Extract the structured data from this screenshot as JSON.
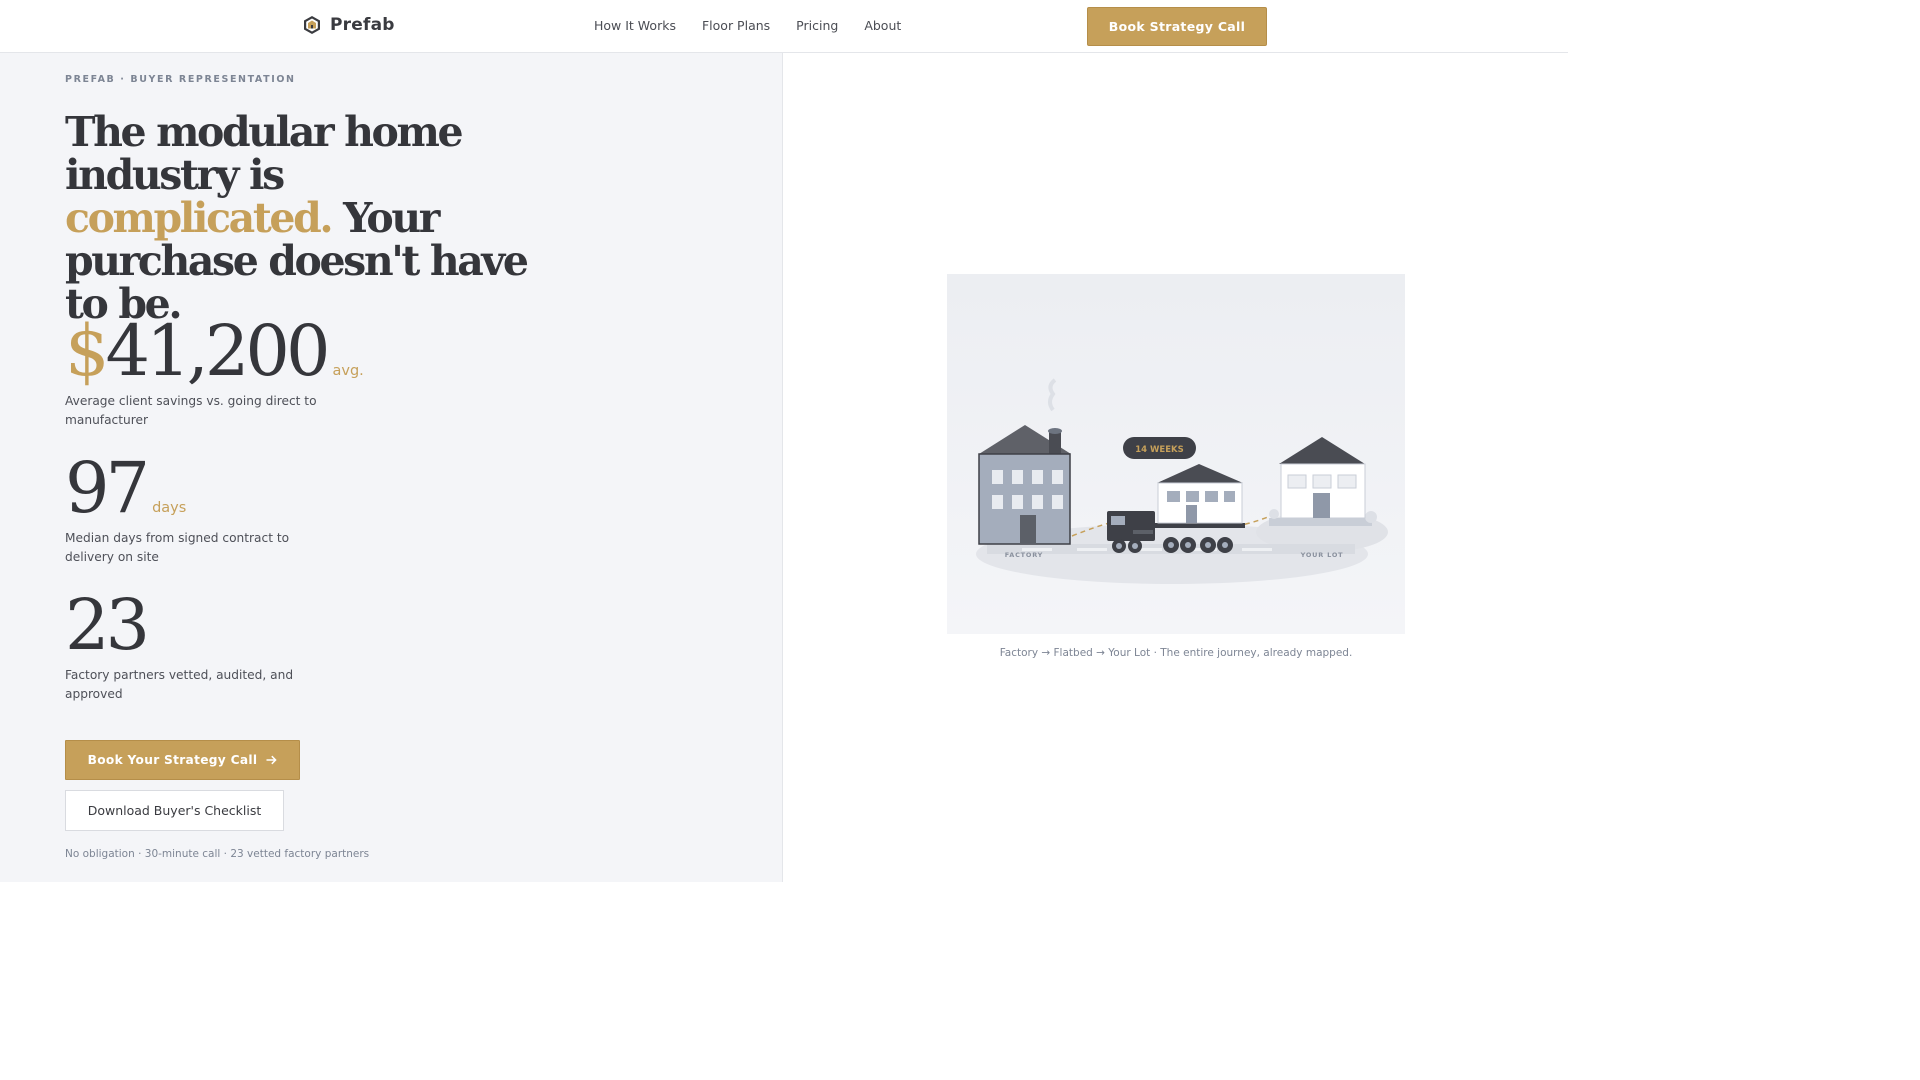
{
  "brand": {
    "name": "Prefab",
    "icon": "hexagon-house-logo"
  },
  "nav": {
    "items": [
      "How It Works",
      "Floor Plans",
      "Pricing",
      "About"
    ]
  },
  "header": {
    "cta_label": "Book Strategy Call"
  },
  "hero": {
    "eyebrow": "PREFAB · BUYER REPRESENTATION",
    "headline_part1": "The modular home industry is ",
    "headline_accent": "complicated.",
    "headline_part2": " Your purchase doesn't have to be."
  },
  "stats": [
    {
      "currency": "$",
      "value": "41,200",
      "unit": "avg.",
      "description": "Average client savings vs. going direct to manufacturer"
    },
    {
      "currency": "",
      "value": "97",
      "unit": "days",
      "description": "Median days from signed contract to delivery on site"
    },
    {
      "currency": "",
      "value": "23",
      "unit": "",
      "description": "Factory partners vetted, audited, and approved"
    }
  ],
  "cta": {
    "primary_label": "Book Your Strategy Call",
    "primary_icon": "arrow-right-icon",
    "secondary_label": "Download Buyer's Checklist",
    "fineprint": "No obligation · 30-minute call · 23 vetted factory partners"
  },
  "illustration": {
    "badge": "14 WEEKS",
    "label_left": "FACTORY",
    "label_right": "YOUR LOT",
    "caption": "Factory → Flatbed → Your Lot · The entire journey, already mapped."
  },
  "colors": {
    "accent": "#c6a05a",
    "text": "#35363b",
    "muted": "#7d8594",
    "panel": "#f4f5f8"
  }
}
